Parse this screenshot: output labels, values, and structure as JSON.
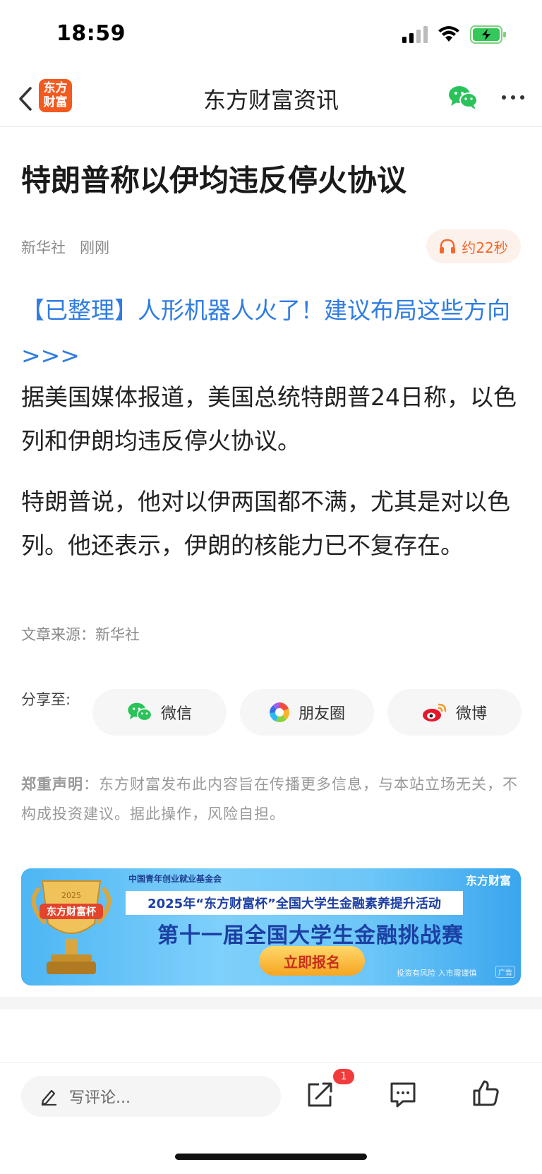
{
  "status_bar": {
    "time": "18:59"
  },
  "nav": {
    "title": "东方财富资讯",
    "logo_text": "东方财富"
  },
  "article": {
    "headline": "特朗普称以伊均违反停火协议",
    "source_name": "新华社",
    "time_ago": "刚刚",
    "audio_duration": "约22秒",
    "promo_link": "【已整理】人形机器人火了！建议布局这些方向>>>",
    "paragraphs": [
      "据美国媒体报道，美国总统特朗普24日称，以色列和伊朗均违反停火协议。",
      "特朗普说，他对以伊两国都不满，尤其是对以色列。他还表示，伊朗的核能力已不复存在。"
    ],
    "article_source": "文章来源：新华社"
  },
  "share": {
    "label": "分享至:",
    "wechat": "微信",
    "moments": "朋友圈",
    "weibo": "微博"
  },
  "disclaimer": {
    "title": "郑重声明",
    "text": "：东方财富发布此内容旨在传播更多信息，与本站立场无关，不构成投资建议。据此操作，风险自担。"
  },
  "banner": {
    "org": "中国青年创业就业基金会",
    "brand": "东方财富",
    "event": "2025年“东方财富杯”全国大学生金融素养提升活动",
    "title": "第十一届全国大学生金融挑战赛",
    "cta": "立即报名",
    "risk": "投资有风险 入市需谨慎",
    "ad_label": "广告",
    "trophy_text": "东方财富杯",
    "trophy_year": "2025"
  },
  "bottom_bar": {
    "comment_placeholder": "写评论...",
    "share_badge": "1"
  },
  "colors": {
    "link": "#2f7de1",
    "accent_orange": "#f06a2a",
    "logo_orange": "#f35a1f",
    "wechat_green": "#29c35a",
    "badge_red": "#f23b3b"
  }
}
